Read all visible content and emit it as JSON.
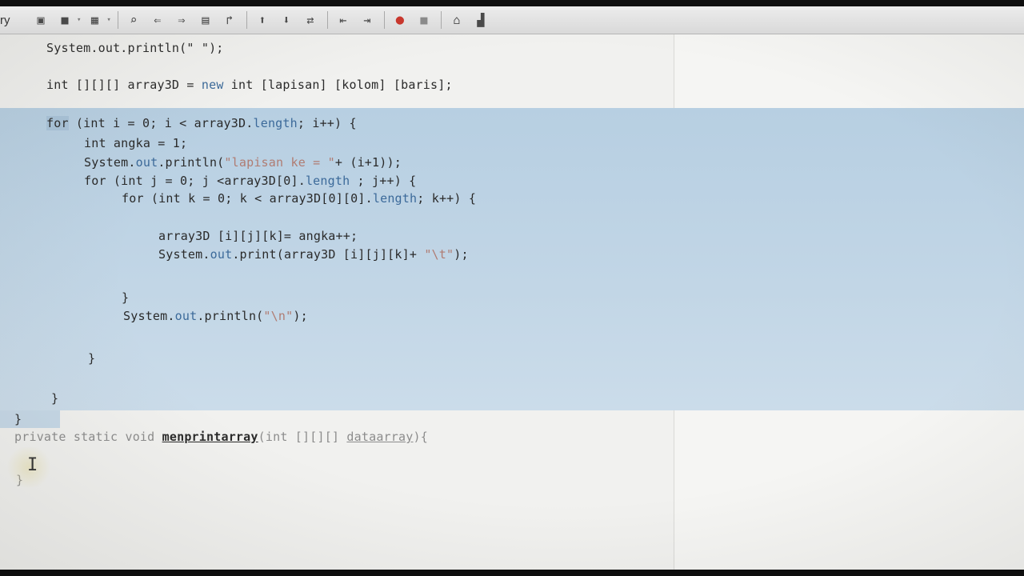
{
  "toolbar": {
    "label": "ry",
    "icons": {
      "save_all": "save-all-icon",
      "save": "save-icon",
      "build": "build-icon",
      "find": "find-icon",
      "run": "run-icon",
      "debug": "debug-icon",
      "profile": "profile-icon",
      "record": "record-icon",
      "stop": "stop-icon"
    },
    "glyphs": {
      "save_all": "▣",
      "save": "■",
      "build": "▦",
      "find": "⌕",
      "find_prev": "⇐",
      "find_next": "⇒",
      "toggle": "▤",
      "bookmark": "↱",
      "prev_bookmark": "⬆",
      "next_bookmark": "⬇",
      "shift": "⇄",
      "indent_left": "⇤",
      "indent_right": "⇥",
      "record": "●",
      "stop": "■",
      "macro": "⌂",
      "last": "▟",
      "dropdown": "▾"
    },
    "accent_record": "#c8372d"
  },
  "editor": {
    "selection_color": "#b7cfe2",
    "lines": {
      "l1": "System.out.println(\" \");",
      "l2a": "int [][][] array3D = ",
      "l2b": "new",
      "l2c": " int [lapisan] [kolom] [baris];",
      "l3a": "for",
      "l3b": " (int i = 0; i < array3D.",
      "l3c": "length",
      "l3d": "; i++) {",
      "l4": "int angka = 1;",
      "l5a": "System.",
      "l5b": "out",
      "l5c": ".println(",
      "l5d": "\"lapisan ke = \"",
      "l5e": "+ (i+1));",
      "l6a": "for (int j = 0; j <array3D[0].",
      "l6b": "length",
      "l6c": " ; j++) {",
      "l7a": "for (int k = 0; k < array3D[0][0].",
      "l7b": "length",
      "l7c": "; k++) {",
      "l8": "array3D [i][j][k]= angka++;",
      "l9a": "System.",
      "l9b": "out",
      "l9c": ".print(array3D [i][j][k]+ ",
      "l9d": "\"\\t\"",
      "l9e": ");",
      "l10": "}",
      "l11a": "System.",
      "l11b": "out",
      "l11c": ".println(",
      "l11d": "\"\\n\"",
      "l11e": ");",
      "l12": "}",
      "l13": "}",
      "l14": "}",
      "l15a": "private static void ",
      "l15b": "menprintarray",
      "l15c": "(int [][][] ",
      "l15d": "dataarray",
      "l15e": "){",
      "l16": "}"
    }
  }
}
